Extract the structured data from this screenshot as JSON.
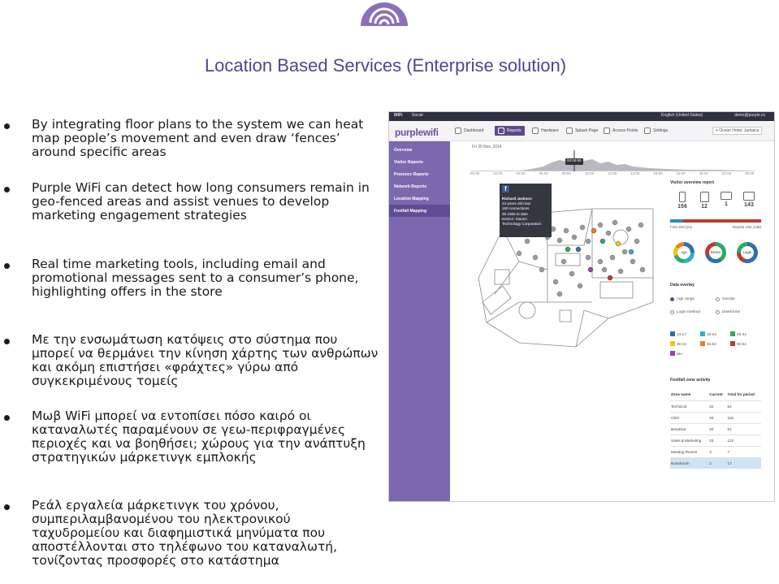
{
  "title": "Location Based Services (Enterprise solution)",
  "brand_color": "#7b68ad",
  "logo": {
    "icon": "wifi-icon",
    "color": "#8a6fbb"
  },
  "bullets": [
    {
      "text": "By integrating floor plans to the system  we can heat map people’s movement and even draw ‘fences’ around specific areas"
    },
    {
      "text": "Purple WiFi can detect how  long consumers remain in geo-fenced areas and assist venues to develop marketing engagement strategies"
    },
    {
      "text": "Real time marketing tools, including email and promotional messages sent to a consumer’s phone, highlighting offers in the store"
    },
    {
      "text": "Με την ενσωμάτωση κατόψεις στο σύστημα που μπορεί να θερμάνει την κίνηση χάρτης των ανθρώπων και ακόμη επιστήσει «φράχτες» γύρω από συγκεκριμένους τομείς"
    },
    {
      "text": "Μωβ WiFi μπορεί να εντοπίσει πόσο καιρό οι καταναλωτές παραμένουν σε γεω-περιφραγμένες περιοχές και να βοηθήσει; χώρους για την ανάπτυξη στρατηγικών μάρκετινγκ εμπλοκής"
    },
    {
      "text": "Ρεάλ εργαλεία μάρκετινγκ του χρόνου, συμπεριλαμβανομένου του ηλεκτρονικού ταχυδρομείου και διαφημιστικά μηνύματα που αποστέλλονται στο τηλέφωνο του καταναλωτή, τονίζοντας προσφορές στο κατάστημα"
    }
  ],
  "app": {
    "topbar": {
      "left1": "WiFi",
      "left2": "Social",
      "language": "English (United States)",
      "user": "demo@purple.co"
    },
    "logo": "purplewifi",
    "nav": [
      {
        "label": "Dashboard",
        "icon": "dashboard-icon"
      },
      {
        "label": "Reports",
        "icon": "reports-icon"
      },
      {
        "label": "Hardware",
        "icon": "hardware-icon"
      },
      {
        "label": "Splash Page",
        "icon": "splash-page-icon"
      },
      {
        "label": "Access Points",
        "icon": "access-points-icon"
      },
      {
        "label": "Settings",
        "icon": "settings-icon"
      }
    ],
    "venue": "Ocean Hotel, Jamaica",
    "sidebar": [
      "Overview",
      "Visitor Reports",
      "Presence Reports",
      "Network Reports",
      "Location Mapping",
      "Footfall Mapping"
    ],
    "date": "Fri 30 Nov, 2014",
    "timeline_marker": "00:00:00",
    "time_ticks": [
      "00:00",
      "02:00",
      "04:00",
      "06:00",
      "08:00",
      "10:00",
      "12:00",
      "14:00",
      "16:00",
      "18:00",
      "20:00",
      "22:00",
      "00:00"
    ],
    "profile_card": {
      "icon": "facebook-icon",
      "name": "Richard Jackson",
      "age": "24 years old man",
      "connections": "150 connections",
      "visits": "25 visits to date",
      "device": "Device: Xiaomi",
      "company": "Technology Corporation"
    },
    "visitor_overview": {
      "title": "Visitor overview report",
      "devices": [
        {
          "icon": "mobile-icon",
          "value": "156"
        },
        {
          "icon": "tablet-icon",
          "value": "12"
        },
        {
          "icon": "laptop-icon",
          "value": "1"
        },
        {
          "icon": "desktop-icon",
          "value": "143"
        }
      ],
      "first_visit_label": "First visit (21)",
      "repeat_visit_label": "Repeat visit (135)",
      "first_visit_fraction": 0.14,
      "donuts": [
        "Age",
        "Device",
        "Login"
      ]
    },
    "data_overlay": {
      "title": "Data overlay",
      "options": [
        "Age range",
        "Gender",
        "Login method",
        "Dwell time"
      ],
      "selected": "Age range"
    },
    "age_legend": [
      {
        "label": "13-17",
        "color": "#2e6fb0"
      },
      {
        "label": "18-24",
        "color": "#2fb0c4"
      },
      {
        "label": "25-34",
        "color": "#27ae60"
      },
      {
        "label": "35-44",
        "color": "#f1c40f"
      },
      {
        "label": "45-54",
        "color": "#e67e22"
      },
      {
        "label": "55-64",
        "color": "#c0392b"
      },
      {
        "label": "65+",
        "color": "#8e44ad"
      }
    ],
    "zone_table": {
      "title": "Footfall zone activity",
      "headers": [
        "Zone name",
        "Current",
        "Total for period"
      ],
      "rows": [
        [
          "Technical",
          "33",
          "64"
        ],
        [
          "CEO",
          "20",
          "119"
        ],
        [
          "Breakout",
          "20",
          "91"
        ],
        [
          "Sales & Marketing",
          "23",
          "122"
        ],
        [
          "Meeting Rooms",
          "3",
          "7"
        ],
        [
          "Boardroom",
          "2",
          "17"
        ]
      ],
      "highlighted_row": 5
    }
  }
}
